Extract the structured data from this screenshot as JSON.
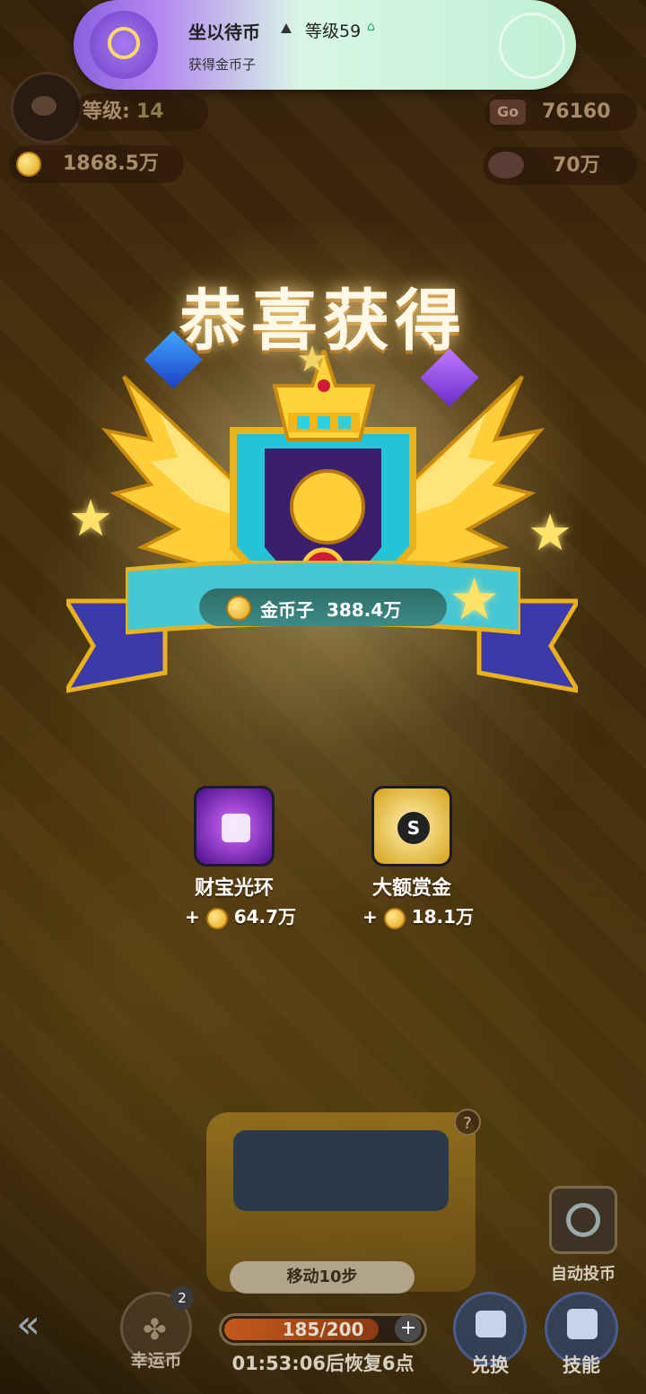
{
  "notification": {
    "title": "坐以待币",
    "level": "等级59",
    "subtitle": "获得金币子"
  },
  "stats": {
    "level_label": "等级:",
    "level_value": "14",
    "coins": "1868.5万",
    "go_icon": "Go",
    "go_value": "76160",
    "secondary_value": "70万"
  },
  "reward": {
    "heading": "恭喜获得",
    "item_name": "金币子",
    "amount": "388.4万"
  },
  "bonuses": [
    {
      "name": "财宝光环",
      "plus": "+",
      "amount": "64.7万",
      "icon": "coin-stack-icon",
      "color": "#7b2ad6"
    },
    {
      "name": "大额赏金",
      "plus": "+",
      "amount": "18.1万",
      "icon": "bounty-icon",
      "color": "#d6a21a"
    }
  ],
  "bottom": {
    "help": "?",
    "move_button": "移动10步",
    "auto_label": "自动投币",
    "lucky_label": "幸运币",
    "lucky_badge": "2",
    "energy_text": "185/200",
    "energy_fraction": 0.925,
    "energy_plus": "+",
    "timer": "01:53:06后恢复6点",
    "exchange_label": "兑换",
    "skill_label": "技能"
  }
}
